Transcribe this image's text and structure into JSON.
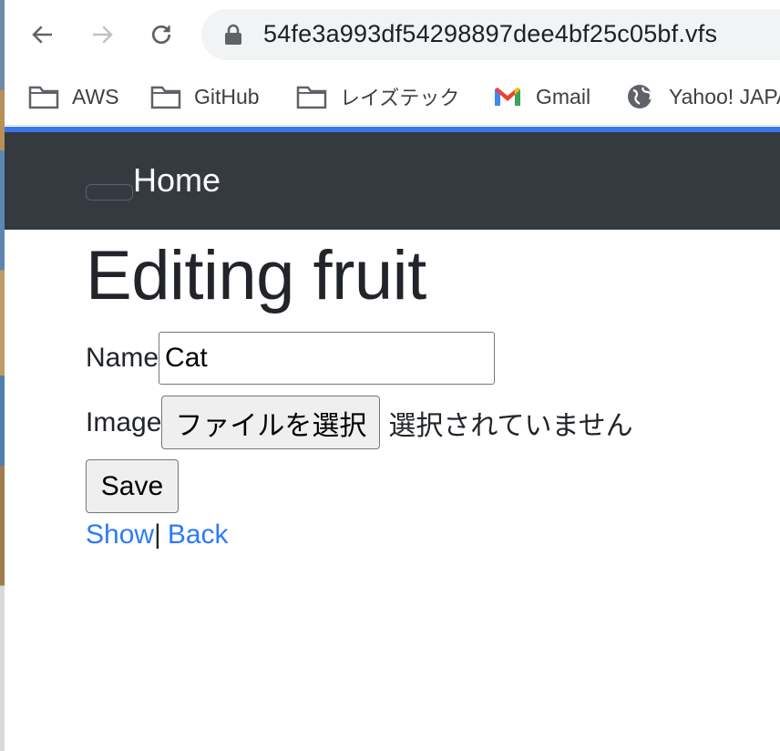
{
  "browser": {
    "url": "54fe3a993df54298897dee4bf25c05bf.vfs",
    "bookmarks": [
      {
        "label": "AWS",
        "icon": "folder-icon"
      },
      {
        "label": "GitHub",
        "icon": "folder-icon"
      },
      {
        "label": "レイズテック",
        "icon": "folder-icon"
      },
      {
        "label": "Gmail",
        "icon": "gmail-icon"
      },
      {
        "label": "Yahoo! JAPAN",
        "icon": "globe-icon"
      }
    ],
    "accent": "#3b78e7"
  },
  "navbar": {
    "brand": "Home",
    "background": "#343a40"
  },
  "page": {
    "title": "Editing fruit",
    "name_label": "Name",
    "name_value": "Cat",
    "image_label": "Image",
    "file_button": "ファイルを選択",
    "file_status": "選択されていません",
    "save_label": "Save",
    "show_link": "Show",
    "separator": "|",
    "back_link": "Back",
    "link_color": "#2e7bf5"
  }
}
